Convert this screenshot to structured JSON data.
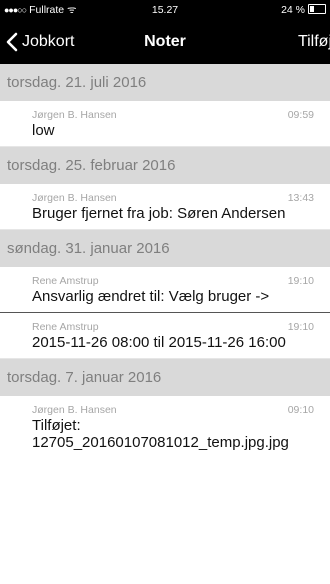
{
  "status_bar": {
    "carrier": "Fullrate",
    "time": "15.27",
    "battery": "24 %"
  },
  "nav": {
    "back_label": "Jobkort",
    "title": "Noter",
    "add_label": "Tilføj"
  },
  "sections": [
    {
      "date": "torsdag. 21. juli 2016",
      "notes": [
        {
          "author": "Jørgen B. Hansen",
          "time": "09:59",
          "text": "low"
        }
      ]
    },
    {
      "date": "torsdag. 25. februar 2016",
      "notes": [
        {
          "author": "Jørgen B. Hansen",
          "time": "13:43",
          "text": "Bruger fjernet fra job: Søren Andersen"
        }
      ]
    },
    {
      "date": "søndag. 31. januar 2016",
      "notes": [
        {
          "author": "Rene Amstrup",
          "time": "19:10",
          "text": "Ansvarlig ændret til: Vælg bruger ->"
        },
        {
          "author": "Rene Amstrup",
          "time": "19:10",
          "text": "2015-11-26 08:00 til 2015-11-26 16:00"
        }
      ]
    },
    {
      "date": "torsdag. 7. januar 2016",
      "notes": [
        {
          "author": "Jørgen B. Hansen",
          "time": "09:10",
          "text": "Tilføjet: 12705_20160107081012_temp.jpg.jpg"
        }
      ]
    }
  ]
}
